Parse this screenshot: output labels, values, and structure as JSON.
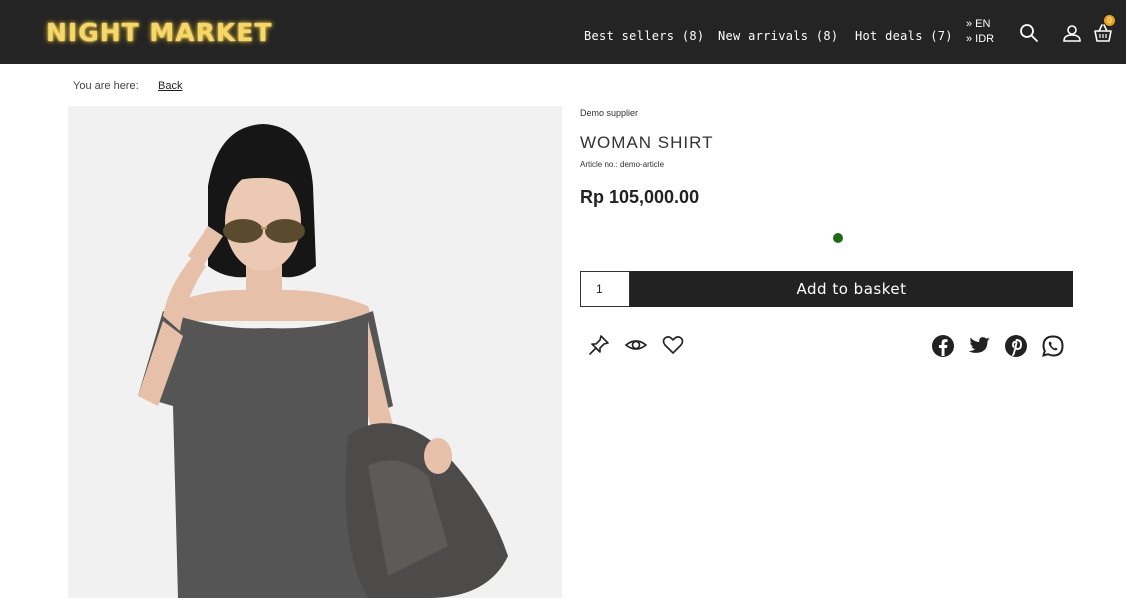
{
  "header": {
    "logo": "NIGHT MARKET",
    "nav": [
      {
        "label": "Best sellers (8)"
      },
      {
        "label": "New arrivals (8)"
      },
      {
        "label": "Hot deals (7)"
      }
    ],
    "language": "» EN",
    "currency": "» IDR",
    "basket_count": "0",
    "icons": [
      "search-icon",
      "user-icon",
      "basket-icon"
    ]
  },
  "breadcrumb": {
    "label": "You are here:",
    "back": "Back"
  },
  "product": {
    "supplier": "Demo supplier",
    "title": "WOMAN SHIRT",
    "article": "Article no.: demo-article",
    "price": "Rp 105,000.00",
    "stock_status_color": "#1e6b17",
    "quantity": "1",
    "add_label": "Add to basket",
    "image": "woman-in-grey-shirt-photo"
  },
  "actions": [
    "pin-icon",
    "eye-icon",
    "heart-icon"
  ],
  "share": [
    "facebook-icon",
    "twitter-icon",
    "pinterest-icon",
    "whatsapp-icon"
  ],
  "colors": {
    "header_bg": "#242424",
    "logo": "#f5d76e",
    "button_bg": "#222222",
    "badge": "#e8a31a"
  }
}
